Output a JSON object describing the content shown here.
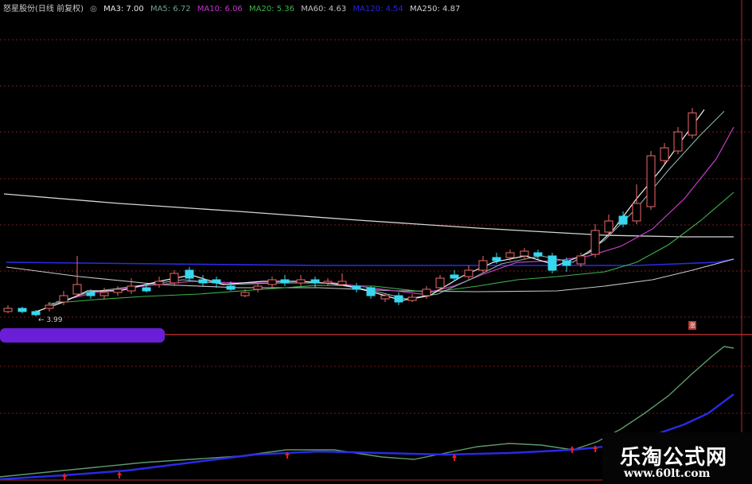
{
  "header": {
    "stock": "怒星股份(日线 前复权)",
    "ma3": "MA3: 7.00",
    "ma5": "MA5: 6.72",
    "ma10": "MA10: 6.06",
    "ma20": "MA20: 5.36",
    "ma60": "MA60: 4.63",
    "ma120": "MA120: 4.54",
    "ma250": "MA250: 4.87"
  },
  "colors": {
    "ma3": "#e8e8e8",
    "ma5": "#7fa79a",
    "ma10": "#c236c8",
    "ma20": "#3db34b",
    "ma60": "#c0c0c0",
    "ma120": "#2424e0",
    "ma250": "#d0d0d0",
    "up": "#f06a6a",
    "down": "#36d8f0",
    "grid": "#8a1f1f"
  },
  "price_low_label": "3.99",
  "tag_label": "涨",
  "watermark": {
    "title": "乐淘公式网",
    "url": "www.60lt.com"
  }
}
